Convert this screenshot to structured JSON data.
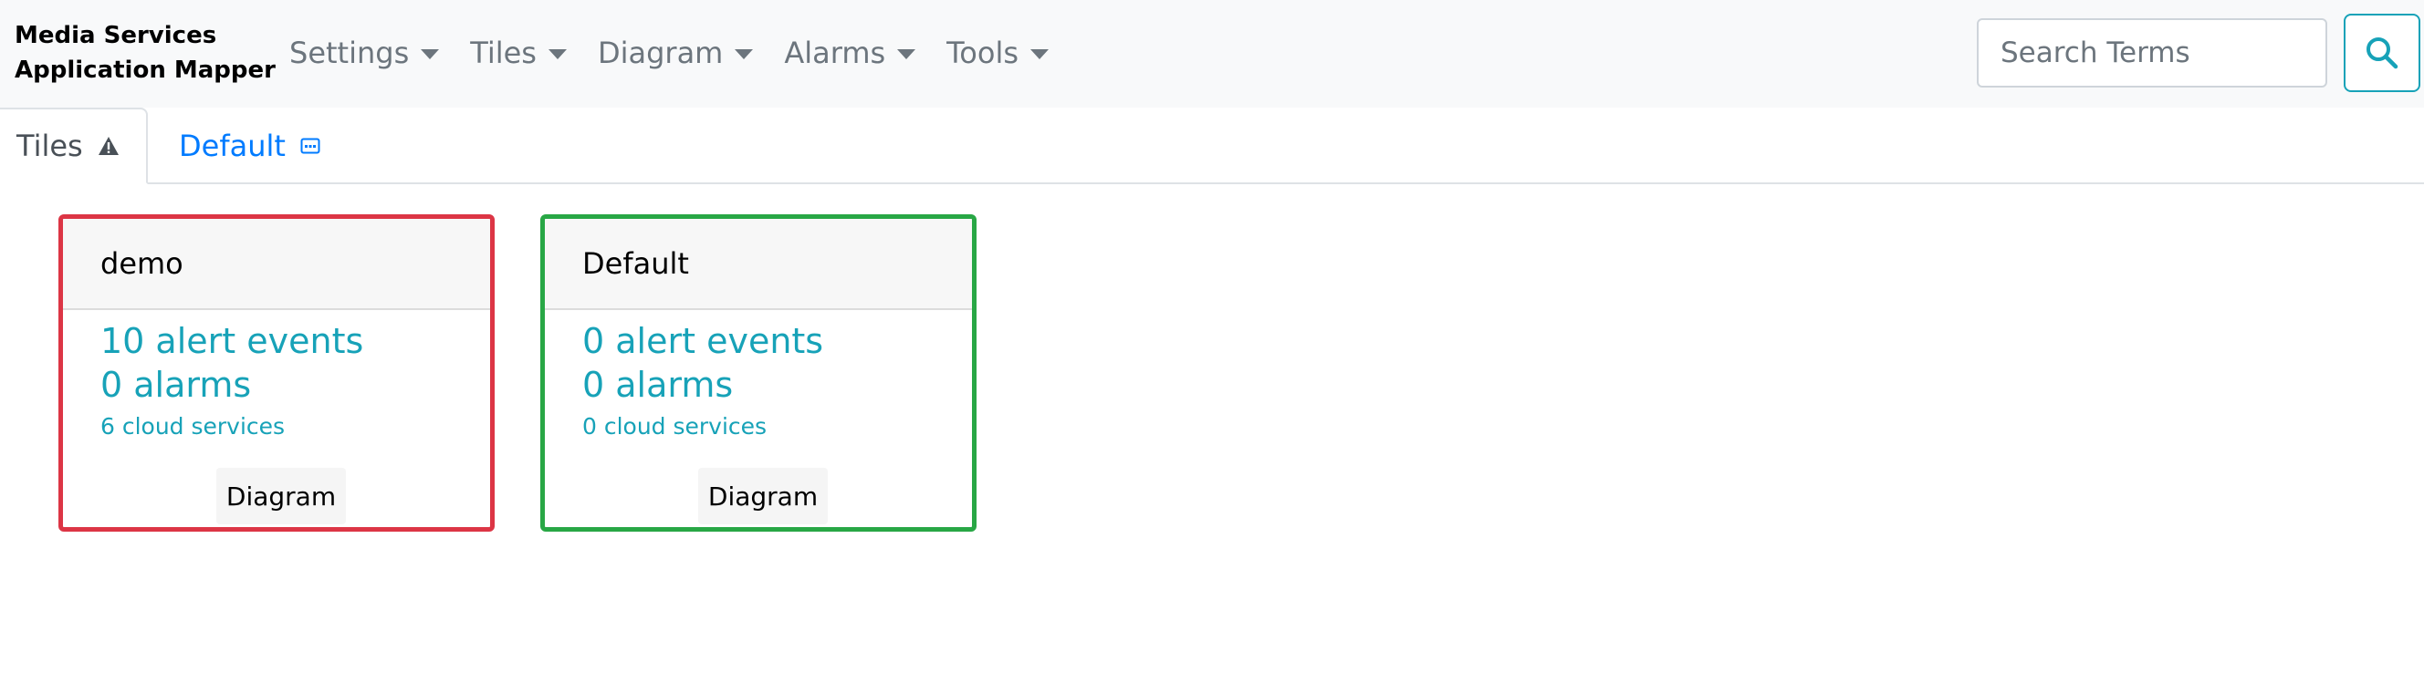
{
  "app": {
    "brand": "Media Services\nApplication Mapper"
  },
  "nav": {
    "items": [
      {
        "label": "Settings"
      },
      {
        "label": "Tiles"
      },
      {
        "label": "Diagram"
      },
      {
        "label": "Alarms"
      },
      {
        "label": "Tools"
      }
    ]
  },
  "search": {
    "placeholder": "Search Terms",
    "value": "",
    "button_icon": "search-icon",
    "accent": "#17a2b8"
  },
  "tabs": [
    {
      "label": "Tiles",
      "icon": "warning-icon",
      "active": true
    },
    {
      "label": "Default",
      "icon": "diagram-box-icon",
      "active": false
    }
  ],
  "tiles": [
    {
      "name": "demo",
      "alert_events": "10 alert events",
      "alarms": "0 alarms",
      "cloud_services": "6 cloud services",
      "button_label": "Diagram",
      "status_color": "#dc3545"
    },
    {
      "name": "Default",
      "alert_events": "0 alert events",
      "alarms": "0 alarms",
      "cloud_services": "0 cloud services",
      "button_label": "Diagram",
      "status_color": "#28a745"
    }
  ],
  "colors": {
    "link_blue": "#007bff",
    "info_teal": "#17a2b8",
    "nav_gray": "#6c757d"
  }
}
